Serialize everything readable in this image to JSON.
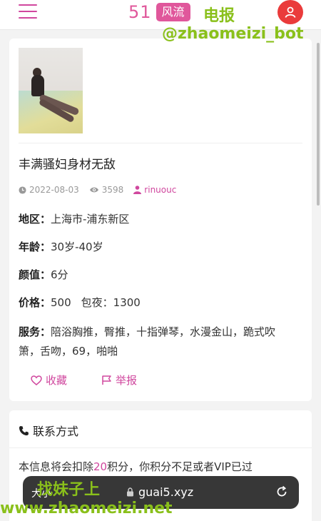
{
  "header": {
    "logo_number": "51",
    "logo_badge": "风流"
  },
  "watermarks": {
    "top_right_1": "电报",
    "top_right_2": "@zhaomeizi_bot",
    "bottom_1": "找妹子上",
    "bottom_2": "www.zhaomeizi.net"
  },
  "post": {
    "title": "丰满骚妇身材无敌",
    "date": "2022-08-03",
    "views": "3598",
    "author": "rinuouc",
    "region_label": "地区：",
    "region": "上海市-浦东新区",
    "age_label": "年龄：",
    "age": "30岁-40岁",
    "looks_label": "颜值：",
    "looks": "6分",
    "price_label": "价格：",
    "price": "500",
    "overnight_label": "包夜：",
    "overnight": "1300",
    "services_label": "服务：",
    "services": "陪浴胸推，臀推，十指弹琴，水漫金山，跪式吹箫，舌吻，69，啪啪",
    "favorite": "收藏",
    "report": "举报"
  },
  "contact": {
    "title": "联系方式",
    "text_before": "本信息将会扣除",
    "points": "20",
    "text_after": "积分，你积分不足或者VIP已过"
  },
  "browser": {
    "text_size": "大小",
    "url": "guai5.xyz"
  },
  "colors": {
    "accent": "#e0579b",
    "avatar": "#ea3b3b",
    "watermark": "#8ac01b"
  }
}
